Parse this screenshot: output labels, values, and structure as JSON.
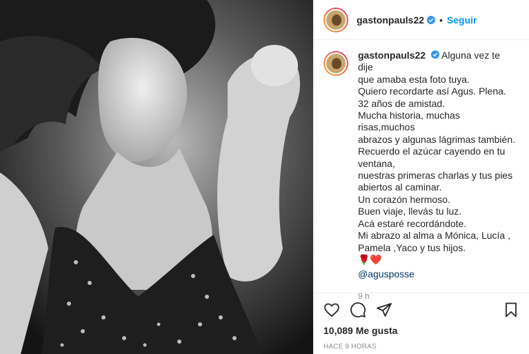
{
  "post": {
    "username": "gastonpauls22",
    "follow_label": "Seguir",
    "separator": "•",
    "caption_lines": [
      "Alguna vez te dije",
      "que amaba esta foto tuya.",
      "Quiero recordarte así Agus. Plena.",
      "32 años de amistad.",
      "Mucha historia, muchas risas,muchos",
      "abrazos y algunas lágrimas también.",
      "Recuerdo el azúcar cayendo en tu",
      "ventana,",
      "nuestras primeras charlas y tus pies",
      "abiertos al caminar.",
      "Un corazón hermoso.",
      "Buen viaje, llevás tu luz.",
      "Acá estaré recordándote.",
      "Mi abrazo al alma a Mónica, Lucía ,",
      "Pamela ,Yaco y tus hijos."
    ],
    "emoji": "🌹❤️",
    "mention": "@agusposse",
    "comment_age": "9 h",
    "likes": "10,089 Me gusta",
    "posted_ago": "HACE 9 HORAS"
  },
  "icons": {
    "verified": "verified-badge-icon",
    "like": "heart-icon",
    "comment": "comment-bubble-icon",
    "share": "paper-plane-icon",
    "save": "bookmark-icon"
  },
  "colors": {
    "link_blue": "#0095f6",
    "mention_blue": "#00376b",
    "muted_gray": "#8e8e8e"
  }
}
